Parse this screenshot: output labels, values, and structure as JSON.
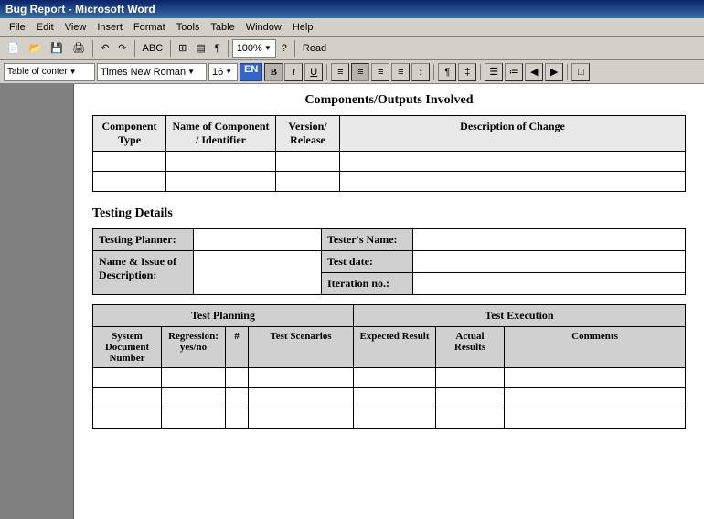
{
  "titleBar": {
    "title": "Bug Report - Microsoft Word"
  },
  "menuBar": {
    "items": [
      "File",
      "Edit",
      "View",
      "Insert",
      "Format",
      "Tools",
      "Table",
      "Window",
      "Help"
    ]
  },
  "toolbar": {
    "zoom": "100%",
    "view": "Read"
  },
  "formatToolbar": {
    "style": "Table of conter",
    "font": "Times New Roman",
    "size": "16",
    "lang": "EN"
  },
  "document": {
    "section1Title": "Components/Outputs Involved",
    "componentsTable": {
      "headers": [
        "Component Type",
        "Name of Component / Identifier",
        "Version/ Release",
        "Description of Change"
      ],
      "rows": [
        [
          "",
          "",
          "",
          ""
        ],
        [
          "",
          "",
          "",
          ""
        ]
      ]
    },
    "section2Title": "Testing Details",
    "testingTable": {
      "rows": [
        {
          "label": "Testing Planner:",
          "value": "",
          "label2": "Tester's Name:",
          "value2": ""
        },
        {
          "label": "Name & Issue of Description:",
          "value": "",
          "label2": "Test date:",
          "value2": ""
        },
        {
          "label": "",
          "value": "",
          "label2": "Iteration no.:",
          "value2": ""
        }
      ]
    },
    "executionTable": {
      "groupHeaders": [
        {
          "label": "Test Planning",
          "colspan": 4
        },
        {
          "label": "Test Execution",
          "colspan": 3
        }
      ],
      "columnHeaders": [
        "System Document Number",
        "Regression: yes/no",
        "#",
        "Test Scenarios",
        "Expected Result",
        "Actual Results",
        "Comments"
      ],
      "rows": [
        [
          "",
          "",
          "",
          "",
          "",
          "",
          ""
        ],
        [
          "",
          "",
          "",
          "",
          "",
          "",
          ""
        ],
        [
          "",
          "",
          "",
          "",
          "",
          "",
          ""
        ]
      ]
    }
  }
}
